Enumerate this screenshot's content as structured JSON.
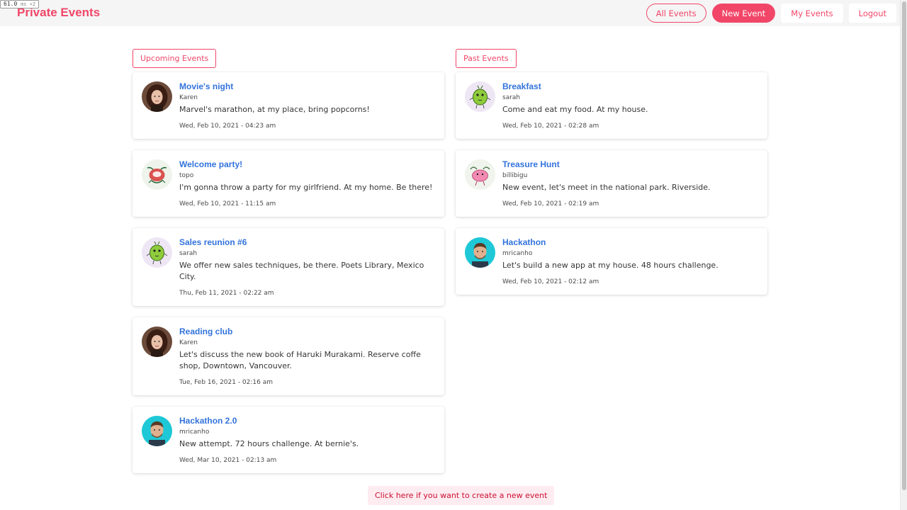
{
  "perf": {
    "value": "61.0",
    "unit": "ms ×2"
  },
  "brand": "Private Events",
  "nav": {
    "all_events": "All Events",
    "new_event": "New Event",
    "my_events": "My Events",
    "logout": "Logout"
  },
  "upcoming": {
    "label": "Upcoming Events",
    "events": [
      {
        "title": "Movie's night",
        "author": "Karen",
        "description": "Marvel's marathon, at my place, bring popcorns!",
        "date": "Wed, Feb 10, 2021 - 04:23 am",
        "avatar": "karen"
      },
      {
        "title": "Welcome party!",
        "author": "topo",
        "description": "I'm gonna throw a party for my girlfriend. At my home. Be there!",
        "date": "Wed, Feb 10, 2021 - 11:15 am",
        "avatar": "topo"
      },
      {
        "title": "Sales reunion #6",
        "author": "sarah",
        "description": "We offer new sales techniques, be there. Poets Library, Mexico City.",
        "date": "Thu, Feb 11, 2021 - 02:22 am",
        "avatar": "sarah"
      },
      {
        "title": "Reading club",
        "author": "Karen",
        "description": "Let's discuss the new book of Haruki Murakami. Reserve coffe shop, Downtown, Vancouver.",
        "date": "Tue, Feb 16, 2021 - 02:16 am",
        "avatar": "karen"
      },
      {
        "title": "Hackathon 2.0",
        "author": "mricanho",
        "description": "New attempt. 72 hours challenge. At bernie's.",
        "date": "Wed, Mar 10, 2021 - 02:13 am",
        "avatar": "mricanho"
      }
    ]
  },
  "past": {
    "label": "Past Events",
    "events": [
      {
        "title": "Breakfast",
        "author": "sarah",
        "description": "Come and eat my food. At my house.",
        "date": "Wed, Feb 10, 2021 - 02:28 am",
        "avatar": "sarah"
      },
      {
        "title": "Treasure Hunt",
        "author": "billibigu",
        "description": "New event, let's meet in the national park. Riverside.",
        "date": "Wed, Feb 10, 2021 - 02:19 am",
        "avatar": "billibigu"
      },
      {
        "title": "Hackathon",
        "author": "mricanho",
        "description": "Let's build a new app at my house. 48 hours challenge.",
        "date": "Wed, Feb 10, 2021 - 02:12 am",
        "avatar": "mricanho"
      }
    ]
  },
  "footer_cta": "Click here if you want to create a new event",
  "colors": {
    "accent": "#f14668",
    "link": "#3273dc",
    "navbar_bg": "#f5f5f5"
  }
}
